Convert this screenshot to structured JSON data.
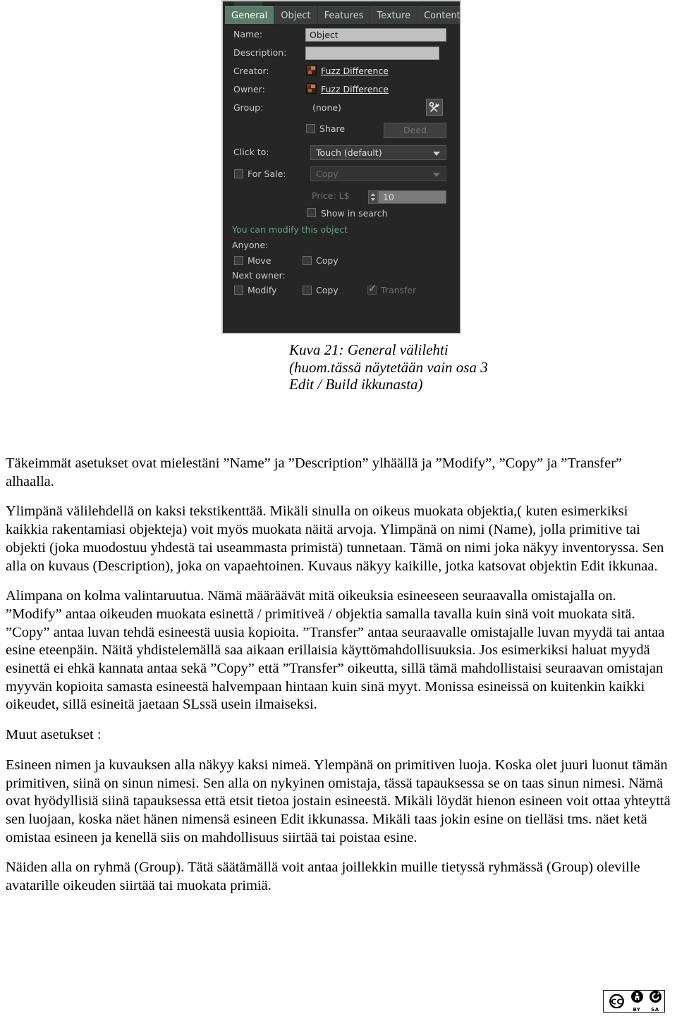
{
  "screenshot": {
    "window_name": "Second Life Edit / Build window — General tab",
    "tabs": [
      {
        "label": "General",
        "active": true
      },
      {
        "label": "Object",
        "active": false
      },
      {
        "label": "Features",
        "active": false
      },
      {
        "label": "Texture",
        "active": false
      },
      {
        "label": "Content",
        "active": false
      }
    ],
    "fields": {
      "name_label": "Name:",
      "name_value": "Object",
      "description_label": "Description:",
      "description_value": "",
      "creator_label": "Creator:",
      "creator_value": "Fuzz Difference",
      "owner_label": "Owner:",
      "owner_value": "Fuzz Difference",
      "group_label": "Group:",
      "group_value": "(none)",
      "share_label": "Share",
      "deed_label": "Deed",
      "click_to_label": "Click to:",
      "click_to_value": "Touch  (default)",
      "for_sale_label": "For Sale:",
      "for_sale_value": "Copy",
      "price_label": "Price: L$",
      "price_value": "10",
      "show_in_search_label": "Show in search",
      "status_text": "You can modify this object",
      "anyone_label": "Anyone:",
      "anyone_move_label": "Move",
      "anyone_copy_label": "Copy",
      "next_owner_label": "Next owner:",
      "next_owner_modify_label": "Modify",
      "next_owner_copy_label": "Copy",
      "next_owner_transfer_label": "Transfer"
    },
    "colors": {
      "panel_bg": "#262626",
      "active_tab": "#5b7a6c",
      "status_green": "#6f9c84",
      "field_bg": "#c0c0c0"
    }
  },
  "caption": {
    "line1": "Kuva 21: General välilehti",
    "line2": "(huom.tässä näytetään  vain osa 3",
    "line3": "Edit / Build ikkunasta)"
  },
  "body": {
    "p1": "Täkeimmät asetukset ovat mielestäni ”Name” ja ”Description” ylhäällä ja ”Modify”, ”Copy” ja ”Transfer” alhaalla.",
    "p2": "Ylimpänä välilehdellä on kaksi tekstikenttää. Mikäli sinulla on oikeus muokata objektia,( kuten esimerkiksi kaikkia rakentamiasi objekteja) voit myös muokata näitä arvoja. Ylimpänä on nimi (Name), jolla primitive tai objekti (joka muodostuu yhdestä tai useammasta primistä) tunnetaan. Tämä on nimi joka näkyy inventoryssa. Sen alla on kuvaus (Description), joka on vapaehtoinen. Kuvaus näkyy kaikille, jotka katsovat objektin Edit ikkunaa.",
    "p3": "Alimpana on kolma valintaruutua. Nämä määräävät mitä oikeuksia esineeseen seuraavalla omistajalla on. ”Modify” antaa oikeuden muokata esinettä / primitiveä / objektia samalla tavalla kuin sinä voit muokata sitä. ”Copy” antaa luvan tehdä esineestä uusia kopioita. ”Transfer” antaa seuraavalle omistajalle luvan myydä tai antaa esine eteenpäin. Näitä yhdistelemällä saa aikaan erillaisia käyttömahdollisuuksia. Jos esimerkiksi haluat myydä esinettä ei ehkä kannata antaa sekä ”Copy” että ”Transfer” oikeutta, sillä tämä mahdollistaisi seuraavan omistajan myyvän kopioita samasta esineestä halvempaan hintaan kuin sinä myyt. Monissa esineissä on kuitenkin kaikki oikeudet, sillä esineitä jaetaan SLssä usein ilmaiseksi.",
    "p4": "Muut asetukset :",
    "p5": "Esineen nimen ja kuvauksen alla näkyy kaksi nimeä. Ylempänä on primitiven luoja. Koska olet juuri luonut tämän primitiven, siinä on sinun nimesi. Sen alla on nykyinen omistaja, tässä tapauksessa se on taas sinun nimesi. Nämä ovat hyödyllisiä siinä tapauksessa että etsit tietoa jostain esineestä. Mikäli löydät hienon esineen voit ottaa yhteyttä sen luojaan, koska näet hänen nimensä esineen Edit ikkunassa. Mikäli taas jokin esine on tielläsi tms. näet ketä omistaa esineen ja kenellä siis on mahdollisuus  siirtää tai poistaa esine.",
    "p6": "Näiden alla on ryhmä (Group). Tätä säätämällä voit antaa joillekkin muille tietyssä ryhmässä (Group) oleville avatarille oikeuden siirtää tai muokata primiä."
  },
  "license": {
    "mark": "CC",
    "by_label": "BY",
    "sa_label": "SA"
  }
}
